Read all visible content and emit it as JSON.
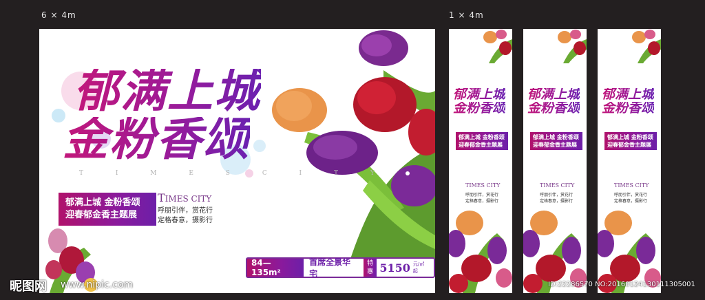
{
  "labels": {
    "big": "6 × 4m",
    "small": "1 × 4m"
  },
  "main": {
    "title1": "郁满上城",
    "title2": "金粉香颂",
    "times_spaced": "T I M E S C I T Y",
    "sub1": "郁满上城 金粉香颂",
    "sub2": "迎春郁金香主题展",
    "eng_t": "T",
    "eng_rest": "IMES CITY",
    "line1": "呼朋引伴，赏花行",
    "line2": "定格春意，摄影行",
    "area": "84—135m²",
    "desc": "首席全景华宅",
    "price_label1": "特",
    "price_label2": "惠",
    "price": "5150",
    "unit": "元/㎡ 起"
  },
  "banner": {
    "title1": "郁满上城",
    "title2": "金粉香颂",
    "sub1": "郁满上城 金粉香颂",
    "sub2": "迎春郁金香主题展",
    "eng_t": "T",
    "eng_rest": "IMES CITY",
    "line1": "呼朋引伴，赏花行",
    "line2": "定格春意，摄影行"
  },
  "watermark": {
    "brand": "昵图网",
    "url": "www.nipic.com",
    "id": "ID:22286570 NO:20160124130111305001"
  },
  "colors": {
    "magenta": "#b0126b",
    "purple": "#6d1fa8",
    "bg": "#231f20"
  }
}
